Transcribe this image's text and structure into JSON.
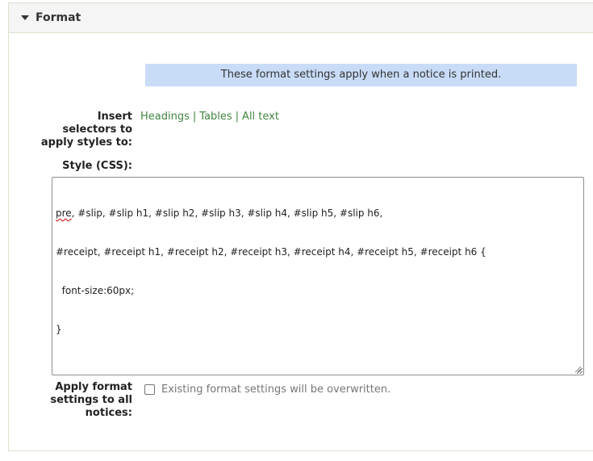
{
  "panel": {
    "title": "Format",
    "expanded": true
  },
  "info": {
    "message": "These format settings apply when a notice is printed."
  },
  "selectors": {
    "label_line1": "Insert",
    "label_line2": "selectors to",
    "label_line3": "apply styles to:",
    "links": [
      {
        "label": "Headings"
      },
      {
        "label": "Tables"
      },
      {
        "label": "All text"
      }
    ],
    "separator": "|"
  },
  "style": {
    "label": "Style (CSS):",
    "lines": [
      {
        "first_word": "pre",
        "rest": ", #slip, #slip h1, #slip h2, #slip h3, #slip h4, #slip h5, #slip h6,"
      },
      {
        "text": "#receipt, #receipt h1, #receipt h2, #receipt h3, #receipt h4, #receipt h5, #receipt h6 {"
      },
      {
        "text": "  font-size:60px;"
      },
      {
        "text": "}"
      }
    ]
  },
  "apply_all": {
    "label_line1": "Apply format",
    "label_line2": "settings to all",
    "label_line3": "notices:",
    "checkbox_label": "Existing format settings will be overwritten.",
    "checked": false
  },
  "colors": {
    "link": "#408540",
    "info_background": "#c9dcf7",
    "panel_border": "#d9e4cf",
    "spellcheck": "#d00000"
  },
  "icons": {
    "toggle": "caret-down-icon",
    "grip": "resize-grip-icon"
  }
}
